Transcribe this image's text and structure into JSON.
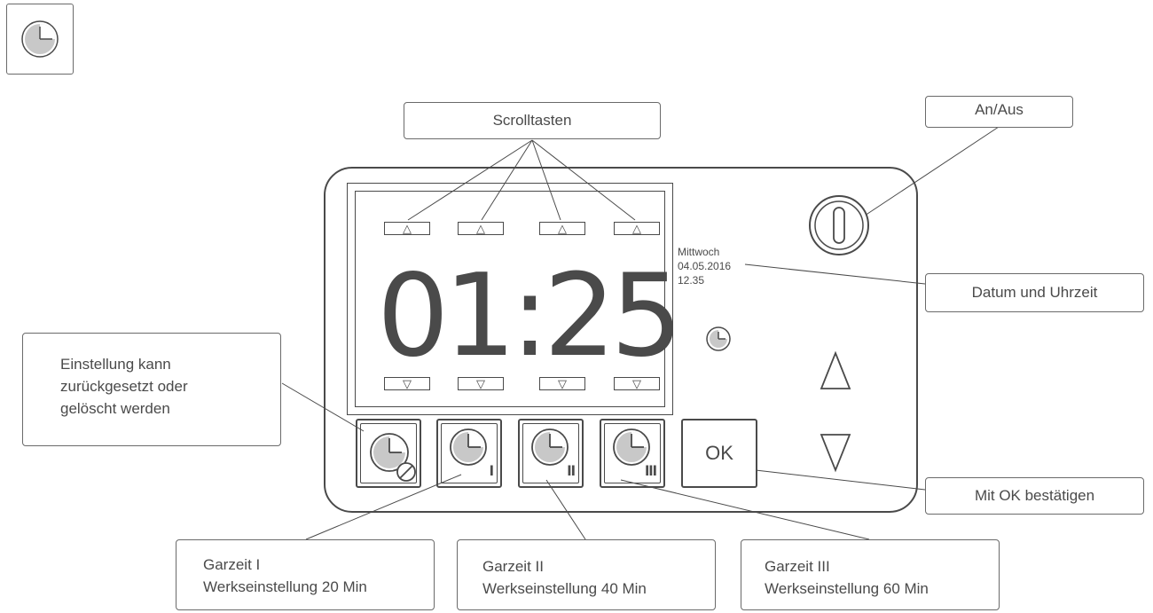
{
  "display": {
    "time": "01:25",
    "weekday": "Mittwoch",
    "date": "04.05.2016",
    "clock": "12.35",
    "scroll_up": "△",
    "scroll_down": "▽"
  },
  "buttons": {
    "ok_label": "OK",
    "garzeit_1_mark": "I",
    "garzeit_2_mark": "II",
    "garzeit_3_mark": "III"
  },
  "callouts": {
    "scrolltasten": "Scrolltasten",
    "an_aus": "An/Aus",
    "datum_uhrzeit": "Datum und Uhrzeit",
    "ok_bestaetigen": "Mit OK bestätigen",
    "reset": [
      "Einstellung kann",
      "zurückgesetzt oder",
      "gelöscht werden"
    ],
    "garzeit_1": [
      "Garzeit I",
      "Werkseinstellung 20 Min"
    ],
    "garzeit_2": [
      "Garzeit II",
      "Werkseinstellung 40 Min"
    ],
    "garzeit_3": [
      "Garzeit III",
      "Werkseinstellung 60 Min"
    ]
  },
  "icons": {
    "header": "clock-icon",
    "power": "power-icon",
    "display_clock": "clock-icon",
    "reset_button": "clock-cancel-icon",
    "side_up": "arrow-up-icon",
    "side_down": "arrow-down-icon"
  },
  "colors": {
    "line": "#4a4a4a",
    "clock_fill": "#c8c8c8",
    "text": "#4a4a4a"
  }
}
